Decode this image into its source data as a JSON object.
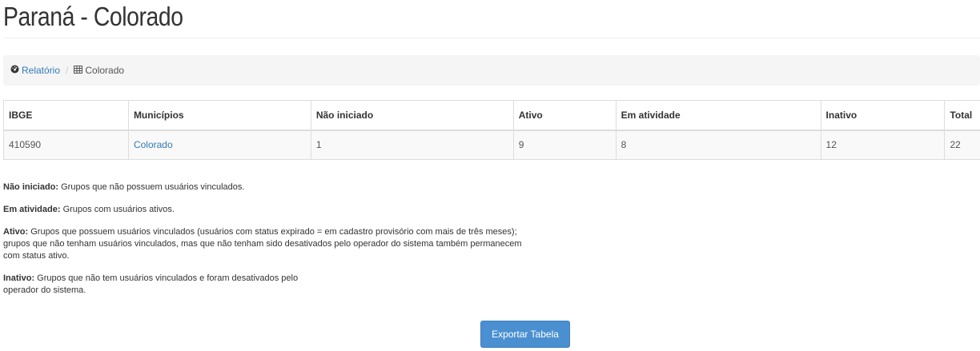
{
  "page": {
    "title": "Paraná - Colorado"
  },
  "breadcrumb": {
    "items": [
      {
        "label": "Relatório",
        "icon": "dashboard-icon"
      },
      {
        "label": "Colorado",
        "icon": "table-icon"
      }
    ],
    "separator": "/"
  },
  "table": {
    "headers": [
      "IBGE",
      "Municípios",
      "Não iniciado",
      "Ativo",
      "Em atividade",
      "Inativo",
      "Total"
    ],
    "rows": [
      [
        "410590",
        "Colorado",
        "1",
        "9",
        "8",
        "12",
        "22"
      ]
    ]
  },
  "notes": [
    {
      "term": "Não iniciado:",
      "text": " Grupos que não possuem usuários vinculados."
    },
    {
      "term": "Em atividade:",
      "text": " Grupos com usuários ativos."
    },
    {
      "term": "Ativo:",
      "text": " Grupos que possuem usuários vinculados (usuários com status expirado = em cadastro provisório com mais de três meses); grupos que não tenham usuários vinculados, mas que não tenham sido desativados pelo operador do sistema também permanecem com status ativo."
    },
    {
      "term": "Inativo:",
      "text": " Grupos que não tem usuários vinculados e foram desativados pelo operador do sistema."
    }
  ],
  "actions": {
    "export_label": "Exportar Tabela"
  },
  "colors": {
    "link": "#337ab7",
    "button": "#4a90d0",
    "breadcrumb_bg": "#f5f5f5",
    "row_bg": "#f9f9f9"
  }
}
